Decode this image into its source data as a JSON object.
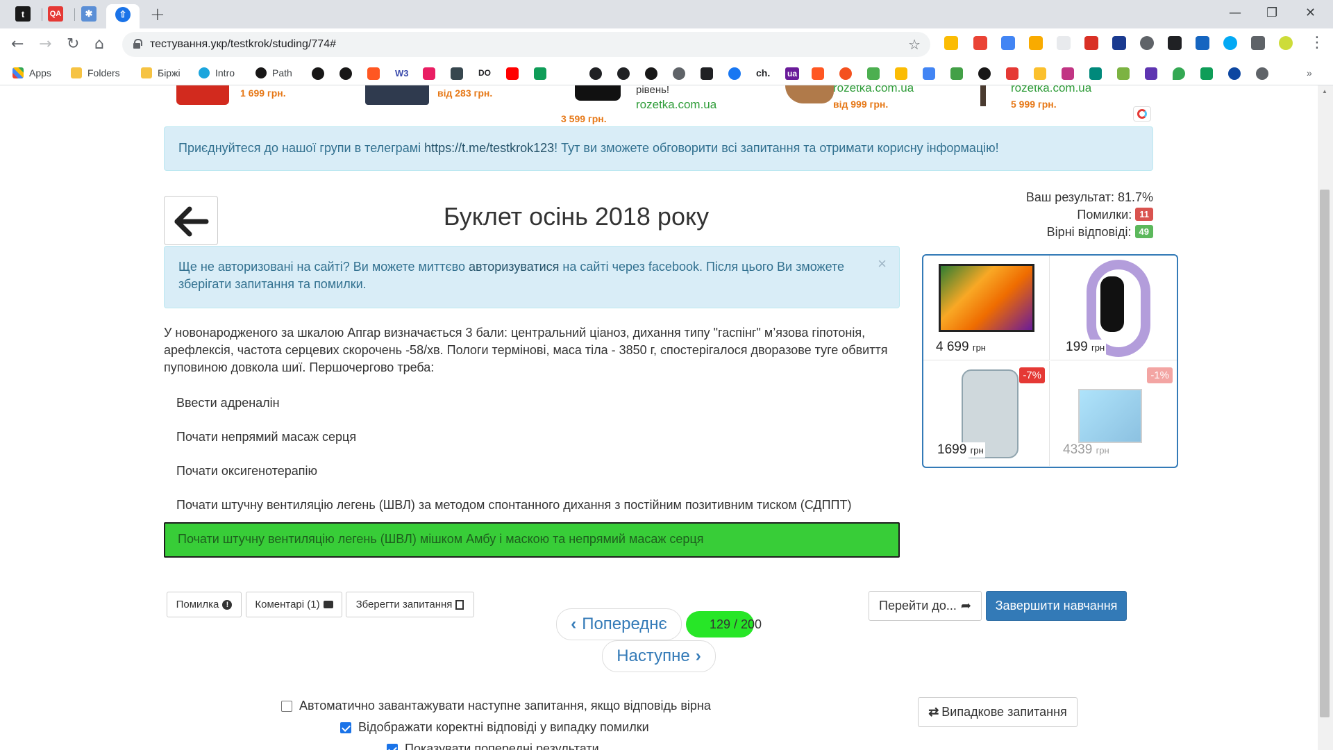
{
  "browser": {
    "tabs": [
      {
        "icon": "t"
      },
      {
        "icon": "QA"
      },
      {
        "icon": "✱"
      },
      {
        "icon": "⇧"
      }
    ],
    "url": "тестування.укр/testkrok/studing/774#",
    "bookmarks": [
      "Apps",
      "Folders",
      "Біржі",
      "Intro",
      "Path"
    ],
    "bookmark_icons": [
      "W3",
      "DO",
      "ch.",
      "ua"
    ]
  },
  "ad_strip": {
    "prices": [
      "1 699 грн.",
      "від 283 грн.",
      "3 599 грн.",
      "від 999 грн.",
      "5 999 грн."
    ],
    "fragment_text": "рівень!",
    "store_links": [
      "rozetka.com.ua",
      "rozetka.com.ua",
      "rozetka.com.ua"
    ]
  },
  "telegram_alert": {
    "text_before": "Приєднуйтеся до нашої групи в телеграмі ",
    "link": "https://t.me/testkrok123",
    "text_after": "! Тут ви зможете обговорити всі запитання та отримати корисну інформацію!"
  },
  "page_title": "Буклет осінь 2018 року",
  "stats": {
    "result_label": "Ваш результат: 81.7%",
    "errors_label": "Помилки:",
    "errors_count": "11",
    "correct_label": "Вірні відповіді:",
    "correct_count": "49",
    "errors_color": "#d9534f",
    "correct_color": "#5cb85c"
  },
  "auth_alert": {
    "text_before": "Ще не авторизовані на сайті? Ви можете миттєво ",
    "link": "авторизуватися",
    "text_after": " на сайті через facebook. Після цього Ви зможете зберігати запитання та помилки.",
    "close": "×"
  },
  "question": "У новонародженого за шкалою Апгар визначається 3 бали: центральний ціаноз, дихання типу \"гаспінг\" м’язова гіпотонія, арефлексія, частота серцевих скорочень -58/хв. Пологи термінові, маса тіла - 3850 г, спостерігалося дворазове туге обвиття пуповиною довкола шиї. Першочергово треба:",
  "answers": [
    {
      "text": "Ввести адреналін",
      "correct": false
    },
    {
      "text": "Почати непрямий масаж серця",
      "correct": false
    },
    {
      "text": "Почати оксигенотерапію",
      "correct": false
    },
    {
      "text": "Почати штучну вентиляцію легень (ШВЛ) за методом спонтанного дихання з постійним позитивним тиском (СДППТ)",
      "correct": false
    },
    {
      "text": "Почати штучну вентиляцію легень (ШВЛ) мішком Амбу і маскою та непрямий масаж серця",
      "correct": true
    }
  ],
  "ad_box": {
    "items": [
      {
        "price": "4 699",
        "currency": "грн",
        "discount": ""
      },
      {
        "price": "199",
        "currency": "грн",
        "discount": ""
      },
      {
        "price": "1699",
        "currency": "грн",
        "discount": "-7%"
      },
      {
        "price": "4339",
        "currency": "грн",
        "discount": "-1%"
      }
    ]
  },
  "actions": {
    "error": "Помилка",
    "comments": "Коментарі",
    "comments_count": "(1)",
    "save": "Зберегти запитання"
  },
  "pager": {
    "prev": "Попереднє",
    "next": "Наступне",
    "current": "129",
    "total": "/ 200"
  },
  "goto_label": "Перейти до...",
  "finish_label": "Завершити навчання",
  "random_label": "Випадкове запитання",
  "options": [
    {
      "label": "Автоматично завантажувати наступне запитання, якщо відповідь вірна",
      "checked": false
    },
    {
      "label": "Відображати коректні відповіді у випадку помилки",
      "checked": true
    },
    {
      "label": "Показувати попередні результати",
      "checked": true
    }
  ]
}
